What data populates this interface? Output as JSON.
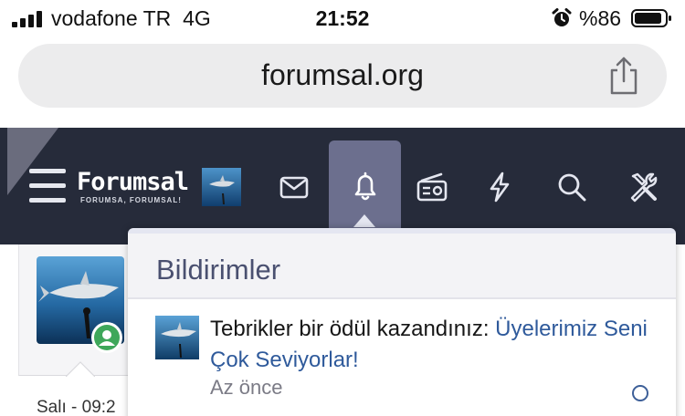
{
  "status_bar": {
    "carrier": "vodafone TR",
    "network": "4G",
    "time": "21:52",
    "battery_percent": "%86",
    "signal_bars": 4
  },
  "browser": {
    "url": "forumsal.org",
    "share_icon": "share-icon"
  },
  "forum": {
    "logo_title": "Forumsal",
    "logo_tagline": "FORUMSA, FORUMSAL!",
    "nav_icons": [
      "menu-icon",
      "envelope-icon",
      "bell-icon",
      "radio-icon",
      "bolt-icon",
      "search-icon",
      "tools-icon"
    ],
    "active_nav": "bell-icon",
    "header_color": "#262b3a",
    "active_tab_color": "#6c6f8e"
  },
  "background_post": {
    "date_fragment": "Salı - 09:2"
  },
  "notifications": {
    "title": "Bildirimler",
    "items": [
      {
        "text": "Tebrikler bir ödül kazandınız: ",
        "link_text": "Üyelerimiz Seni Çok Seviyorlar!",
        "time": "Az önce",
        "link_color": "#2f5a9b"
      }
    ]
  }
}
